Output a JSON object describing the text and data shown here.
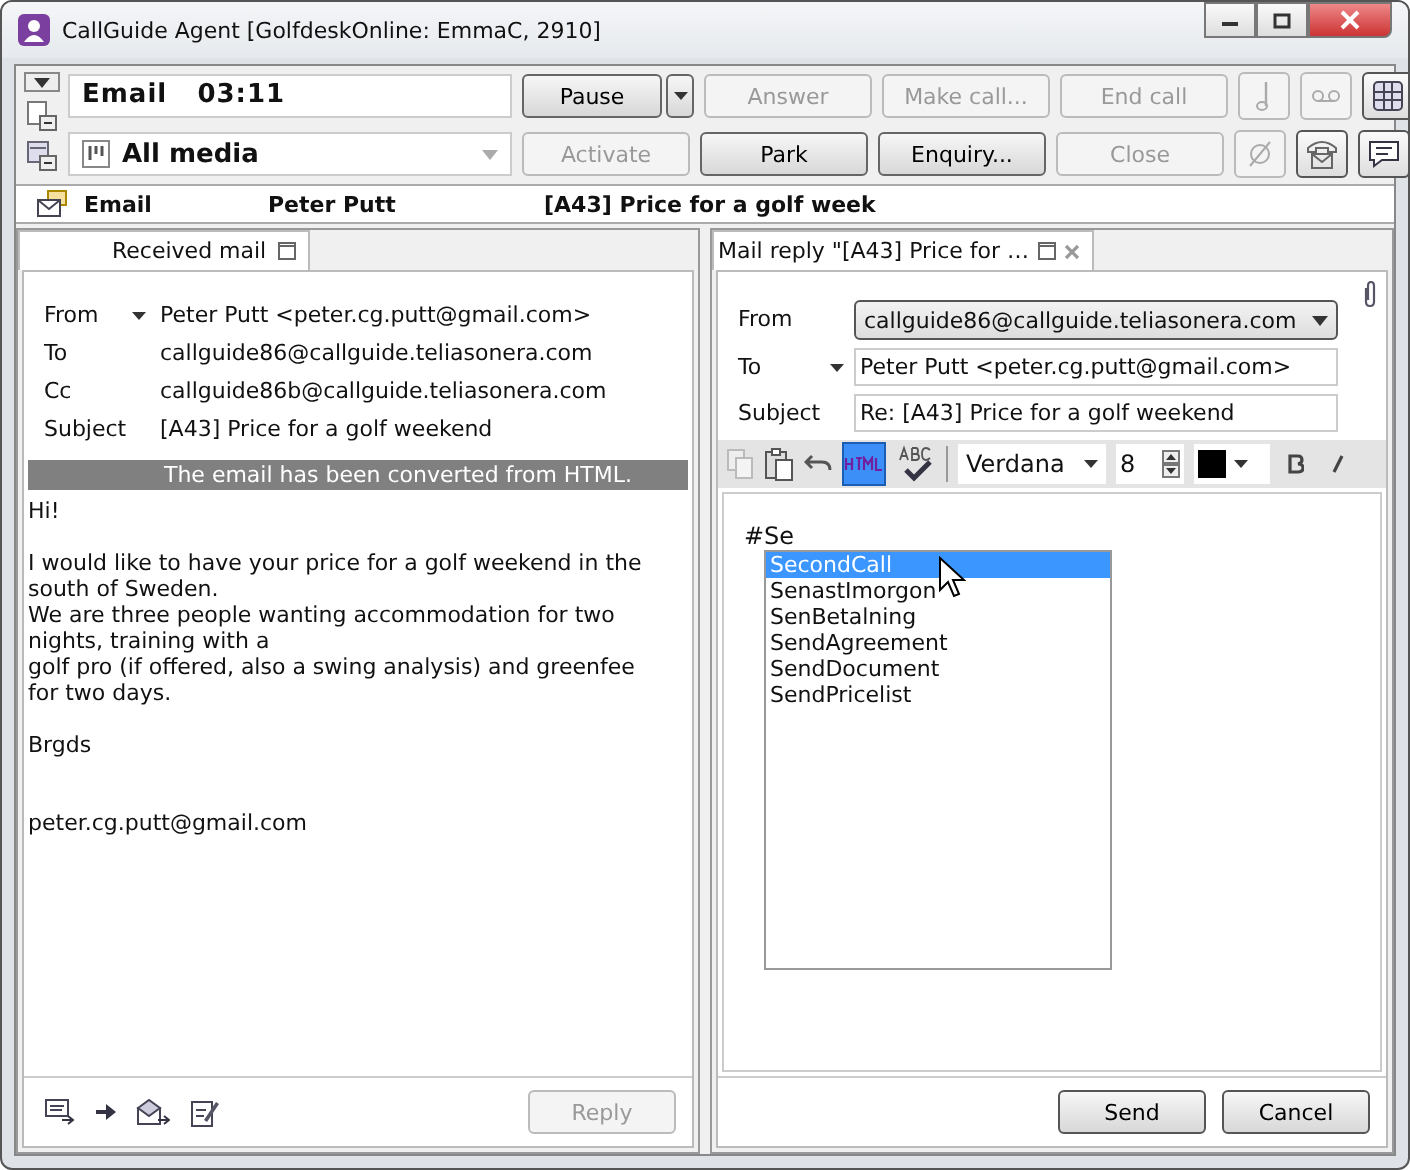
{
  "window": {
    "title": "CallGuide Agent [GolfdeskOnline: EmmaC, 2910]"
  },
  "toolbar": {
    "status": {
      "media": "Email",
      "time": "03:11"
    },
    "media_select": "All media",
    "row1": [
      {
        "label": "Pause",
        "disabled": false,
        "kind": "split"
      },
      {
        "label": "Answer",
        "disabled": true,
        "kind": "plain"
      },
      {
        "label": "Make call...",
        "disabled": true,
        "kind": "plain"
      },
      {
        "label": "End call",
        "disabled": true,
        "kind": "plain"
      }
    ],
    "row2": [
      {
        "label": "Activate",
        "disabled": true,
        "kind": "plain"
      },
      {
        "label": "Park",
        "disabled": false,
        "kind": "plain"
      },
      {
        "label": "Enquiry...",
        "disabled": false,
        "kind": "plain"
      },
      {
        "label": "Close",
        "disabled": true,
        "kind": "plain"
      }
    ]
  },
  "header": {
    "type": "Email",
    "name": "Peter Putt",
    "subject": "[A43] Price for a golf week"
  },
  "received": {
    "tab": "Received mail",
    "fields": [
      {
        "label": "From",
        "value": "Peter Putt <peter.cg.putt@gmail.com>",
        "dropdown": true
      },
      {
        "label": "To",
        "value": "callguide86@callguide.teliasonera.com",
        "dropdown": false
      },
      {
        "label": "Cc",
        "value": "callguide86b@callguide.teliasonera.com",
        "dropdown": false
      },
      {
        "label": "Subject",
        "value": "[A43] Price for a golf weekend",
        "dropdown": false
      }
    ],
    "notice": "The email has been converted from HTML.",
    "paragraphs": [
      {
        "kind": "text",
        "lines": [
          "Hi!"
        ]
      },
      {
        "kind": "text",
        "lines": [
          "I would like to have your price for a golf weekend in the",
          "south of Sweden.",
          "We are three people wanting accommodation for two",
          "nights, training with a",
          "golf pro (if offered, also a swing analysis) and greenfee",
          "for two days."
        ]
      },
      {
        "kind": "text",
        "lines": [
          "Brgds"
        ]
      },
      {
        "kind": "signature",
        "lines": [
          "peter.cg.putt@gmail.com"
        ]
      }
    ],
    "reply_button": {
      "label": "Reply",
      "disabled": true
    }
  },
  "reply": {
    "tab": "Mail reply \"[A43] Price for …",
    "from": {
      "label": "From",
      "value": "callguide86@callguide.teliasonera.com"
    },
    "to": {
      "label": "To",
      "value": "Peter Putt <peter.cg.putt@gmail.com>"
    },
    "subject": {
      "label": "Subject",
      "value": "Re: [A43] Price for a golf weekend"
    },
    "format": {
      "html": true,
      "font": "Verdana",
      "size": "8"
    },
    "editor_text": "#Se",
    "suggestions": [
      {
        "label": "SecondCall",
        "selected": true
      },
      {
        "label": "SenastImorgon",
        "selected": false
      },
      {
        "label": "SenBetalning",
        "selected": false
      },
      {
        "label": "SendAgreement",
        "selected": false
      },
      {
        "label": "SendDocument",
        "selected": false
      },
      {
        "label": "SendPricelist",
        "selected": false
      }
    ],
    "buttons": [
      "Send",
      "Cancel"
    ]
  }
}
